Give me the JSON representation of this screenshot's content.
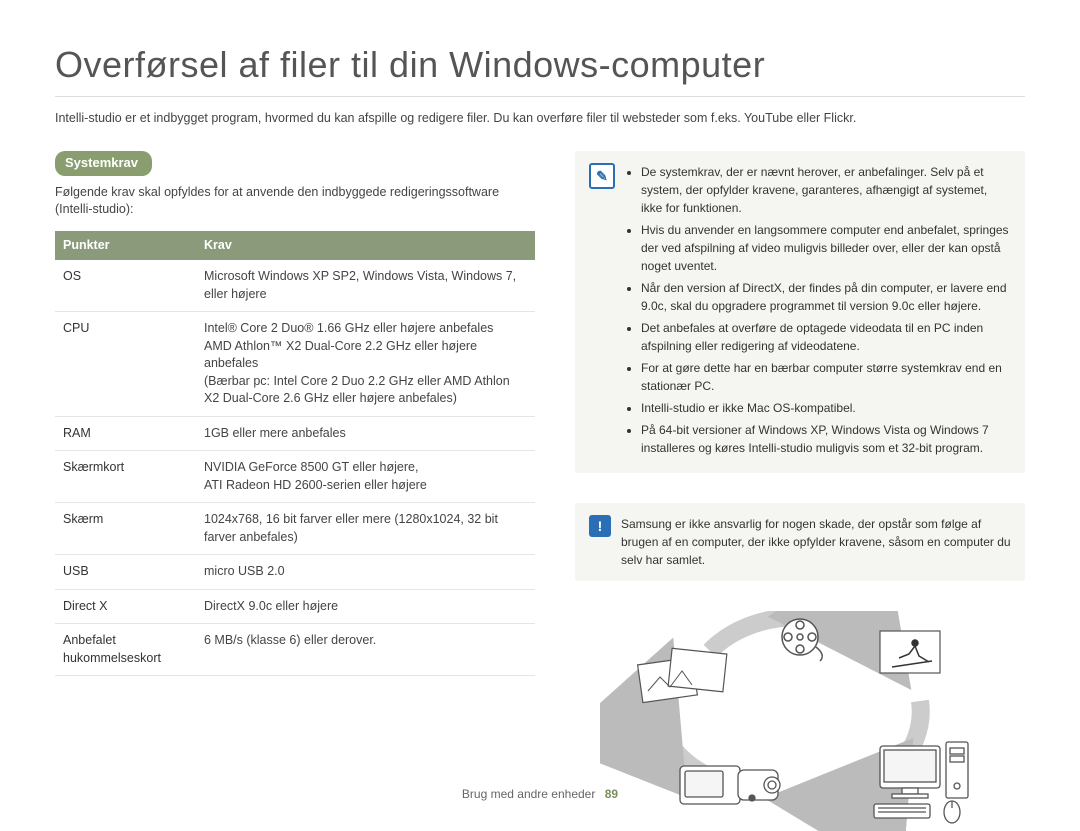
{
  "title": "Overførsel af filer til din Windows-computer",
  "intro": "Intelli-studio er et indbygget program, hvormed du kan afspille og redigere filer. Du kan overføre filer til websteder som f.eks. YouTube eller Flickr.",
  "section": {
    "heading": "Systemkrav",
    "desc": "Følgende krav skal opfyldes for at anvende den indbyggede redigeringssoftware (Intelli-studio):"
  },
  "table": {
    "headers": [
      "Punkter",
      "Krav"
    ],
    "rows": [
      {
        "pk": "OS",
        "val": "Microsoft Windows XP SP2, Windows Vista, Windows 7, eller højere"
      },
      {
        "pk": "CPU",
        "val": "Intel® Core 2 Duo® 1.66 GHz eller højere anbefales\nAMD Athlon™ X2 Dual-Core 2.2 GHz eller højere anbefales\n(Bærbar pc: Intel Core 2 Duo 2.2 GHz eller AMD Athlon X2 Dual-Core 2.6 GHz eller højere anbefales)"
      },
      {
        "pk": "RAM",
        "val": "1GB eller mere anbefales"
      },
      {
        "pk": "Skærmkort",
        "val": "NVIDIA GeForce 8500 GT eller højere,\nATI Radeon HD 2600-serien eller højere"
      },
      {
        "pk": "Skærm",
        "val": "1024x768, 16 bit farver eller mere (1280x1024, 32 bit farver anbefales)"
      },
      {
        "pk": "USB",
        "val": "micro USB 2.0"
      },
      {
        "pk": "Direct X",
        "val": "DirectX 9.0c eller højere"
      },
      {
        "pk": "Anbefalet hukommelseskort",
        "val": "6 MB/s (klasse 6) eller derover."
      }
    ]
  },
  "info_notes": [
    "De systemkrav, der er nævnt herover, er anbefalinger. Selv på et system, der opfylder kravene, garanteres, afhængigt af systemet, ikke for funktionen.",
    "Hvis du anvender en langsommere computer end anbefalet, springes der ved afspilning af video muligvis billeder over, eller der kan opstå noget uventet.",
    "Når den version af DirectX, der findes på din computer, er lavere end 9.0c, skal du opgradere programmet til version 9.0c eller højere.",
    "Det anbefales at overføre de optagede videodata til en PC inden afspilning eller redigering af videodatene.",
    "For at gøre dette har en bærbar computer større systemkrav end en stationær PC.",
    "Intelli-studio er ikke Mac OS-kompatibel.",
    "På 64-bit versioner af Windows XP, Windows Vista og Windows 7 installeres og køres Intelli-studio muligvis som et 32-bit program."
  ],
  "warning_note": "Samsung er ikke ansvarlig for nogen skade, der opstår som følge af brugen af en computer, der ikke opfylder kravene, såsom en computer du selv har samlet.",
  "footer": {
    "section": "Brug med andre enheder",
    "page": "89"
  }
}
